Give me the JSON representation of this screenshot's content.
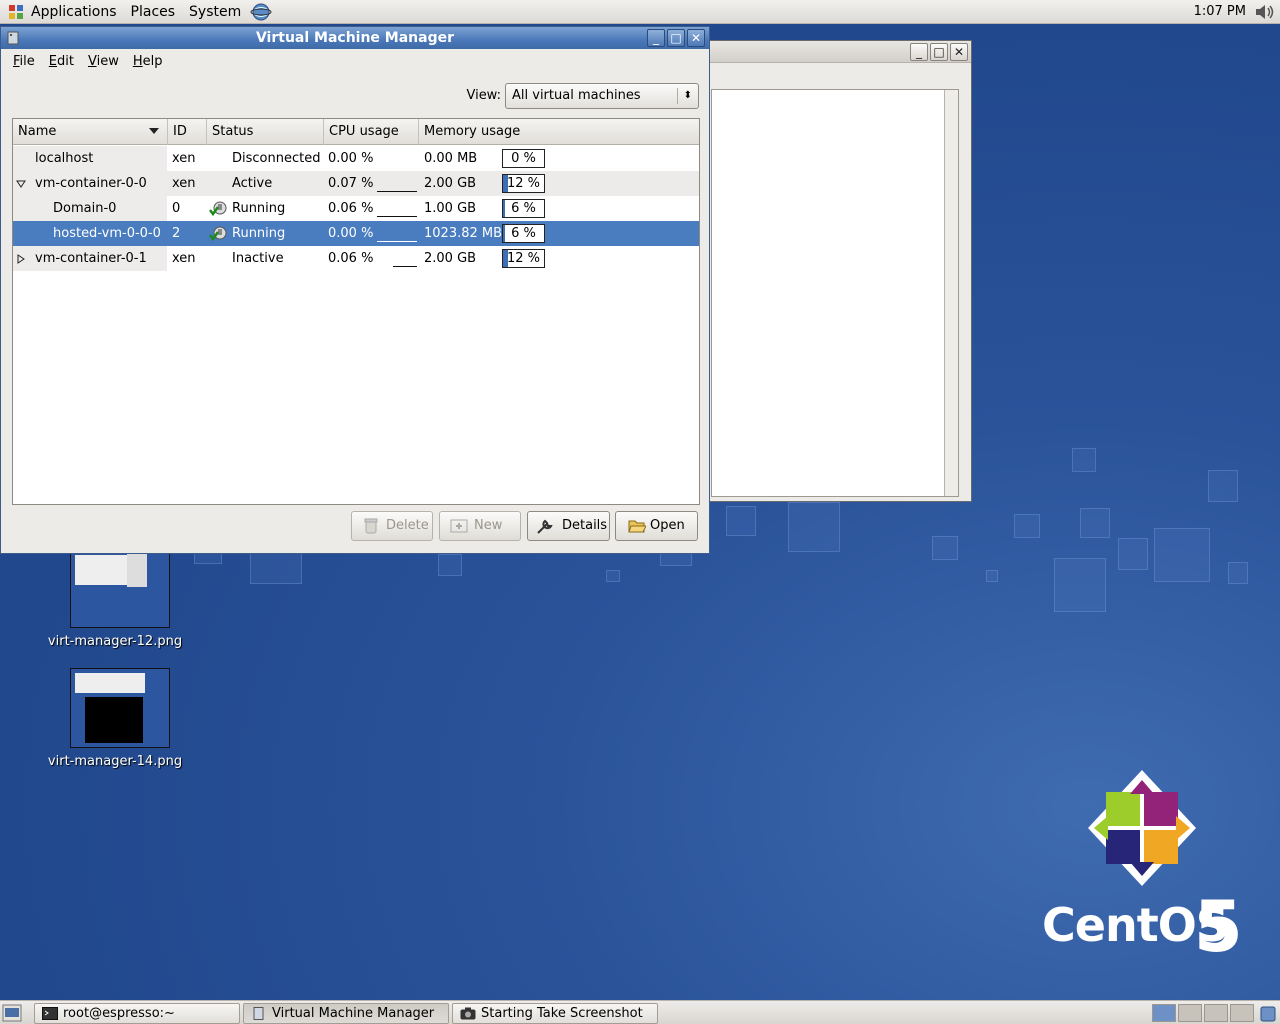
{
  "top_panel": {
    "menus": [
      "Applications",
      "Places",
      "System"
    ],
    "clock": "1:07 PM"
  },
  "main_window": {
    "title": "Virtual Machine Manager",
    "menus": [
      "File",
      "Edit",
      "View",
      "Help"
    ],
    "view_label": "View:",
    "view_selected": "All virtual machines",
    "columns": [
      "Name",
      "ID",
      "Status",
      "CPU usage",
      "Memory usage"
    ],
    "rows": [
      {
        "name": "localhost",
        "id": "xen",
        "status": "Disconnected",
        "cpu": "0.00 %",
        "mem": "0.00 MB",
        "mem_pct": "0 %",
        "mem_fill": 0
      },
      {
        "name": "vm-container-0-0",
        "id": "xen",
        "status": "Active",
        "cpu": "0.07 %",
        "mem": "2.00 GB",
        "mem_pct": "12 %",
        "mem_fill": 0.12
      },
      {
        "name": "Domain-0",
        "id": "0",
        "status": "Running",
        "cpu": "0.06 %",
        "mem": "1.00 GB",
        "mem_pct": "6 %",
        "mem_fill": 0.06
      },
      {
        "name": "hosted-vm-0-0-0",
        "id": "2",
        "status": "Running",
        "cpu": "0.00 %",
        "mem": "1023.82 MB",
        "mem_pct": "6 %",
        "mem_fill": 0.06
      },
      {
        "name": "vm-container-0-1",
        "id": "xen",
        "status": "Inactive",
        "cpu": "0.06 %",
        "mem": "2.00 GB",
        "mem_pct": "12 %",
        "mem_fill": 0.12
      }
    ],
    "buttons": {
      "delete": "Delete",
      "new": "New",
      "details": "Details",
      "open": "Open"
    }
  },
  "desktop_icons": [
    {
      "label": "virt-manager-12.png"
    },
    {
      "label": "virt-manager-14.png"
    }
  ],
  "branding": {
    "name": "CentOS",
    "version": "5"
  },
  "taskbar": {
    "tasks": [
      "root@espresso:~",
      "Virtual Machine Manager",
      "Starting Take Screenshot"
    ]
  },
  "colors": {
    "selection": "#4a7dc0",
    "desktop": "#21488d",
    "titlebar": "#4a78b8"
  }
}
